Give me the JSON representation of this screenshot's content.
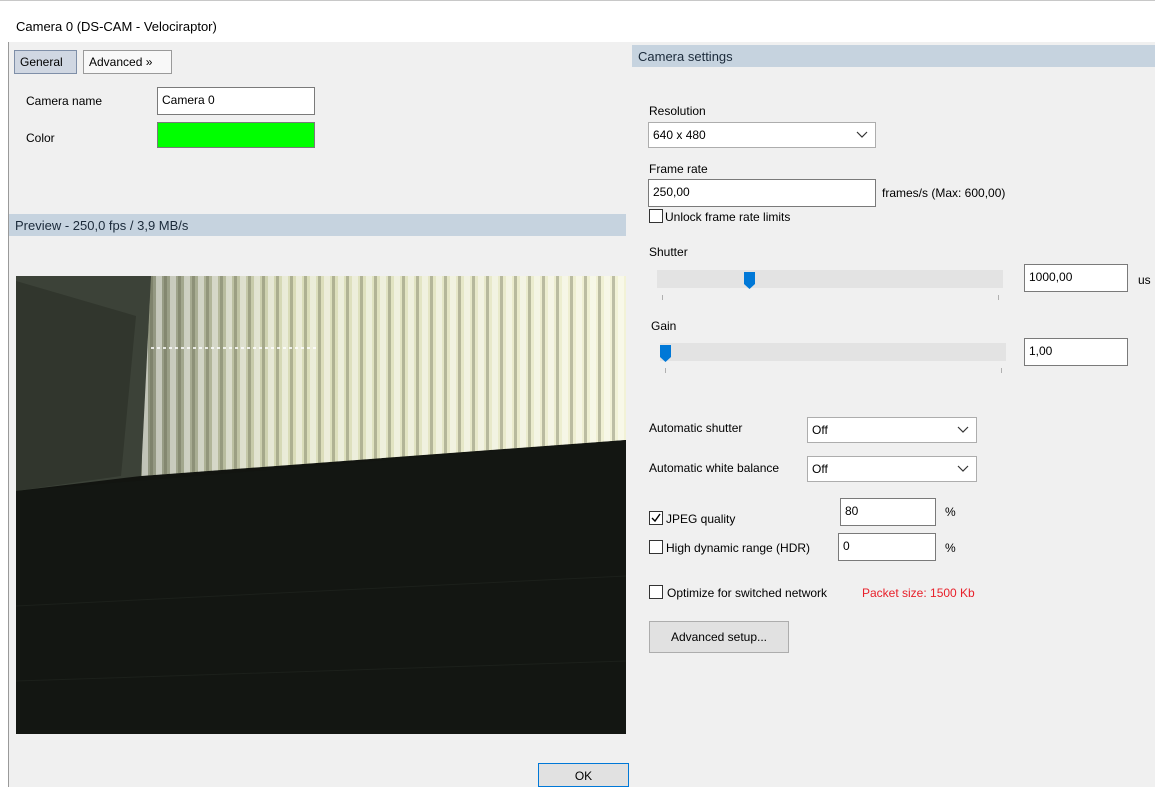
{
  "window": {
    "title": "Camera 0 (DS-CAM - Velociraptor)"
  },
  "tabs": {
    "general": "General",
    "advanced": "Advanced »"
  },
  "general": {
    "camera_name_label": "Camera name",
    "camera_name_value": "Camera 0",
    "color_label": "Color",
    "color_value": "#00ff00"
  },
  "preview": {
    "header": "Preview  -  250,0 fps / 3,9 MB/s"
  },
  "settings": {
    "header": "Camera settings",
    "resolution_label": "Resolution",
    "resolution_value": "640 x 480",
    "frame_rate_label": "Frame rate",
    "frame_rate_value": "250,00",
    "frame_rate_unit": "frames/s (Max: 600,00)",
    "unlock_label": "Unlock frame rate limits",
    "unlock_checked": false,
    "shutter_label": "Shutter",
    "shutter_value": "1000,00",
    "shutter_unit": "us",
    "shutter_slider_fraction": 0.26,
    "gain_label": "Gain",
    "gain_value": "1,00",
    "gain_slider_fraction": 0.0,
    "auto_shutter_label": "Automatic shutter",
    "auto_shutter_value": "Off",
    "auto_wb_label": "Automatic white balance",
    "auto_wb_value": "Off",
    "jpeg_label": "JPEG quality",
    "jpeg_checked": true,
    "jpeg_value": "80",
    "jpeg_unit": "%",
    "hdr_label": "High dynamic range (HDR)",
    "hdr_checked": false,
    "hdr_value": "0",
    "hdr_unit": "%",
    "optimize_label": "Optimize for switched network",
    "optimize_checked": false,
    "packet_size": "Packet size: 1500 Kb",
    "packet_color": "#e8202a",
    "advanced_setup": "Advanced setup..."
  },
  "footer": {
    "ok": "OK"
  },
  "colors": {
    "accent": "#0078d7",
    "section_header_bg": "#c6d3df"
  }
}
